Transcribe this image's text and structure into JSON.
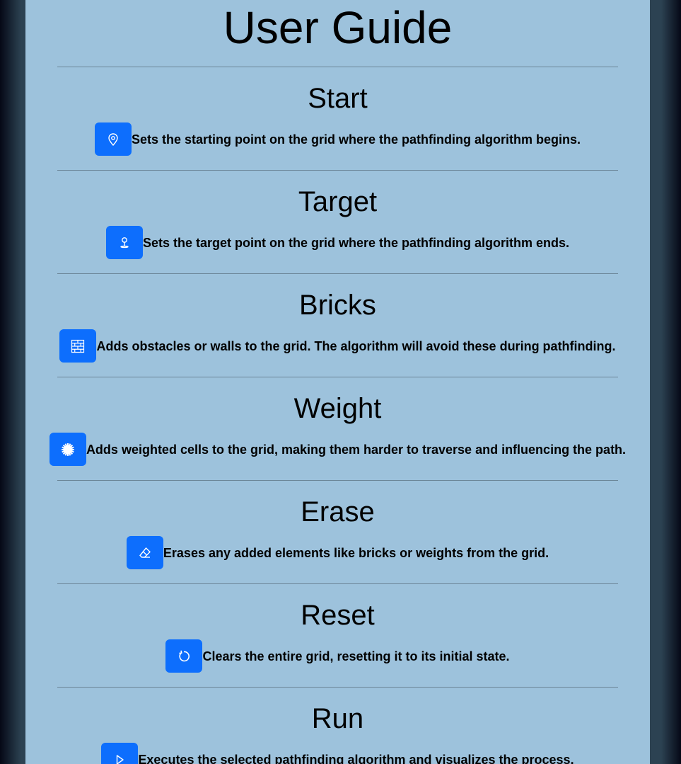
{
  "page": {
    "title": "User Guide"
  },
  "sections": [
    {
      "title": "Start",
      "description": "Sets the starting point on the grid where the pathfinding algorithm begins.",
      "icon": "map-pin-icon"
    },
    {
      "title": "Target",
      "description": "Sets the target point on the grid where the pathfinding algorithm ends.",
      "icon": "target-pin-icon"
    },
    {
      "title": "Bricks",
      "description": "Adds obstacles or walls to the grid. The algorithm will avoid these during pathfinding.",
      "icon": "bricks-icon"
    },
    {
      "title": "Weight",
      "description": "Adds weighted cells to the grid, making them harder to traverse and influencing the path.",
      "icon": "weight-gear-icon"
    },
    {
      "title": "Erase",
      "description": "Erases any added elements like bricks or weights from the grid.",
      "icon": "eraser-icon"
    },
    {
      "title": "Reset",
      "description": "Clears the entire grid, resetting it to its initial state.",
      "icon": "reset-icon"
    },
    {
      "title": "Run",
      "description": "Executes the selected pathfinding algorithm and visualizes the process.",
      "icon": "play-icon"
    }
  ],
  "colors": {
    "panel_background": "#9dc2dc",
    "button_background": "#0d6efd",
    "divider": "#6b8597"
  }
}
